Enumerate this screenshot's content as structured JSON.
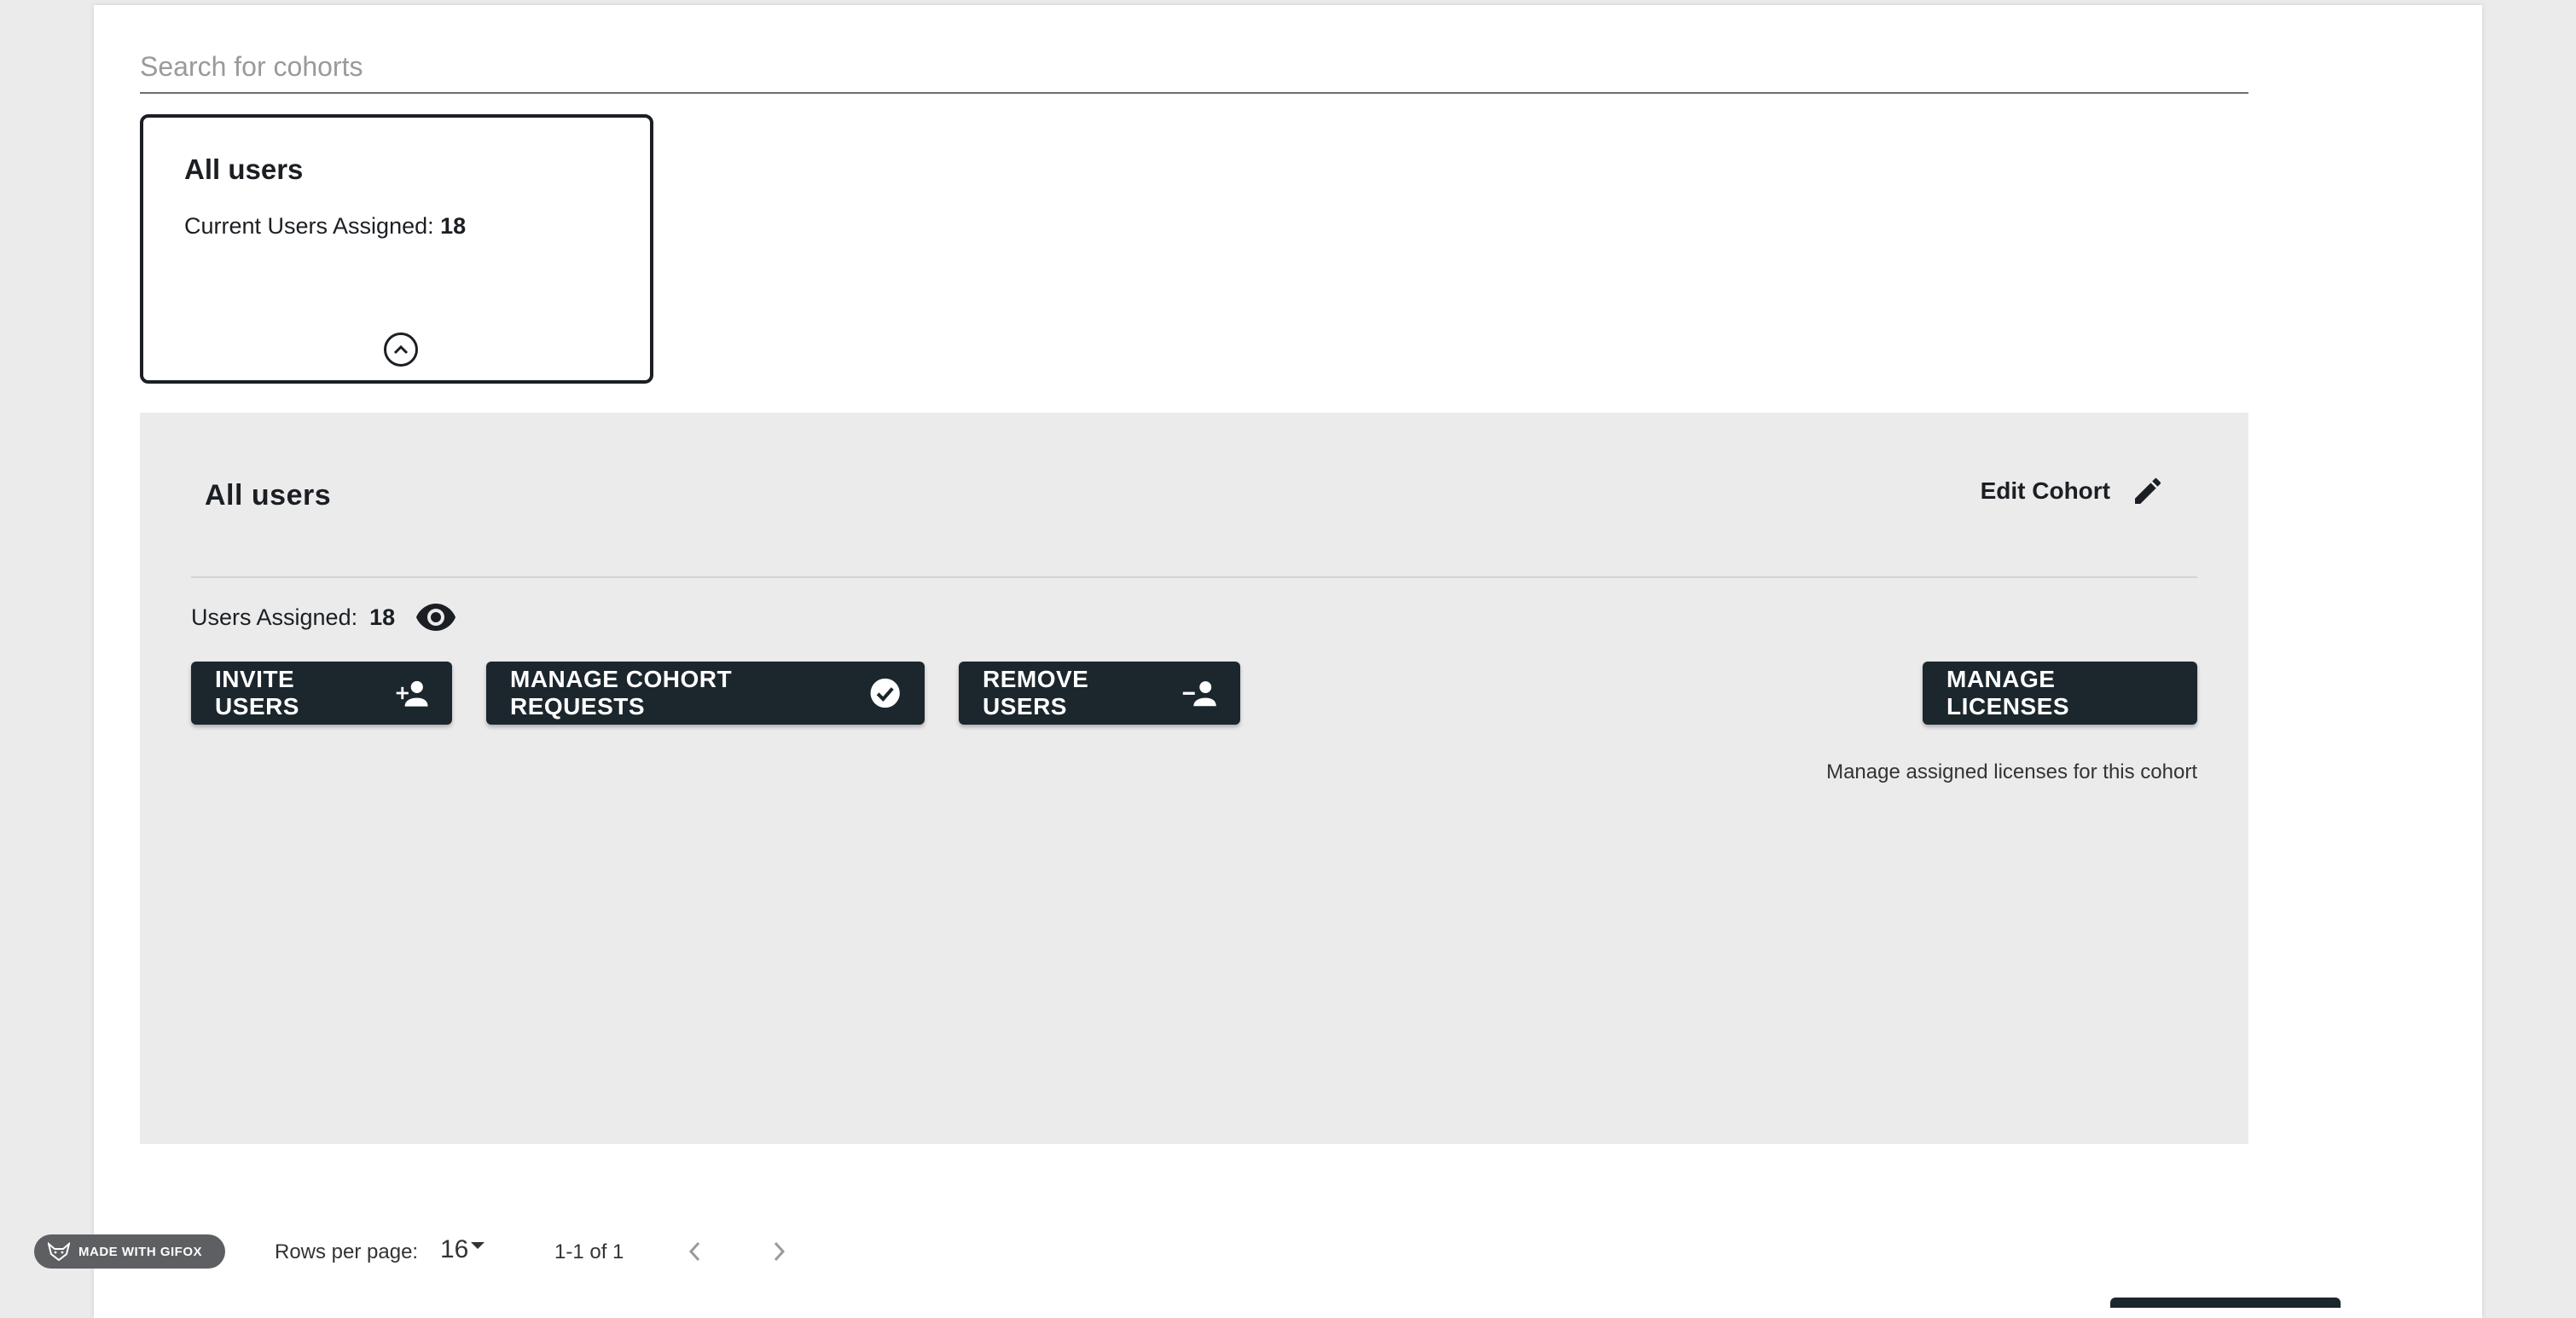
{
  "search": {
    "placeholder": "Search for cohorts"
  },
  "card": {
    "title": "All users",
    "count_label": "Current Users Assigned:",
    "count_value": "18"
  },
  "panel": {
    "title": "All users",
    "edit_label": "Edit Cohort",
    "assigned_label": "Users Assigned:",
    "assigned_value": "18",
    "buttons": {
      "invite": "INVITE USERS",
      "requests": "MANAGE COHORT REQUESTS",
      "remove": "REMOVE USERS",
      "licenses": "MANAGE LICENSES"
    },
    "licenses_note": "Manage assigned licenses for this cohort"
  },
  "pagination": {
    "rows_label": "Rows per page:",
    "rows_value": "16",
    "range": "1-1 of 1"
  },
  "watermark": {
    "label": "MADE WITH GIFOX"
  },
  "colors": {
    "button_bg": "#1b262d",
    "panel_bg": "#ebebec",
    "page_bg": "#ffffff"
  }
}
